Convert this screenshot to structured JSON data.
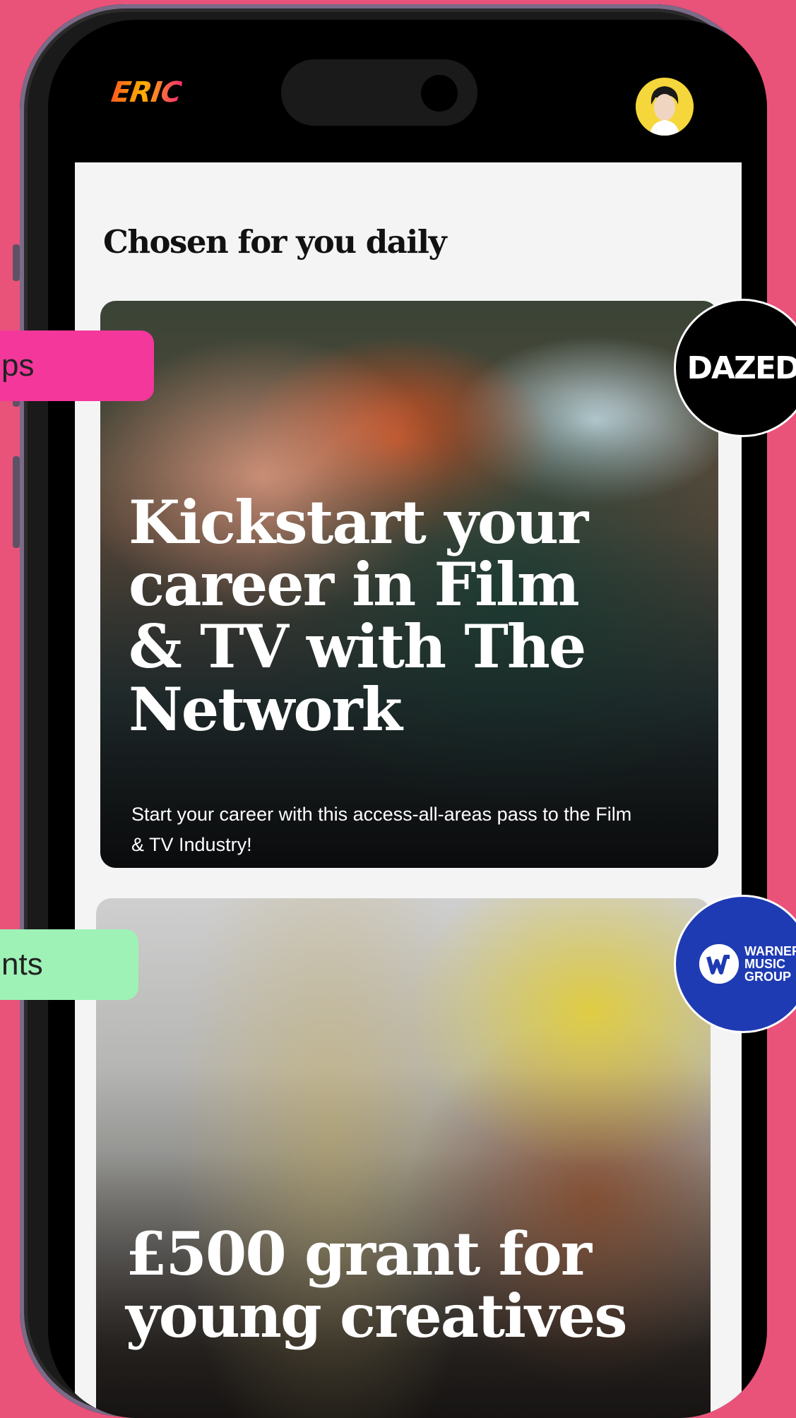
{
  "header": {
    "logo_text": "ERIC",
    "avatar_icon": "user-avatar-icon"
  },
  "feed": {
    "section_title": "Chosen for you daily",
    "cards": [
      {
        "title": "Kickstart your career in Film & TV with The Network",
        "description": "Start your career with this access-all-areas pass to the Film & TV Industry!",
        "partner": "DAZED"
      },
      {
        "title": "£500 grant for young creatives",
        "partner_lines": [
          "WARNER",
          "MUSIC",
          "GROUP"
        ]
      }
    ]
  },
  "floating_tags": {
    "tag1": "ps",
    "tag2": "nts"
  },
  "colors": {
    "background": "#e9537a",
    "tag1": "#f3379b",
    "tag2": "#9ef2b6",
    "warner_blue": "#1f3bb3"
  }
}
